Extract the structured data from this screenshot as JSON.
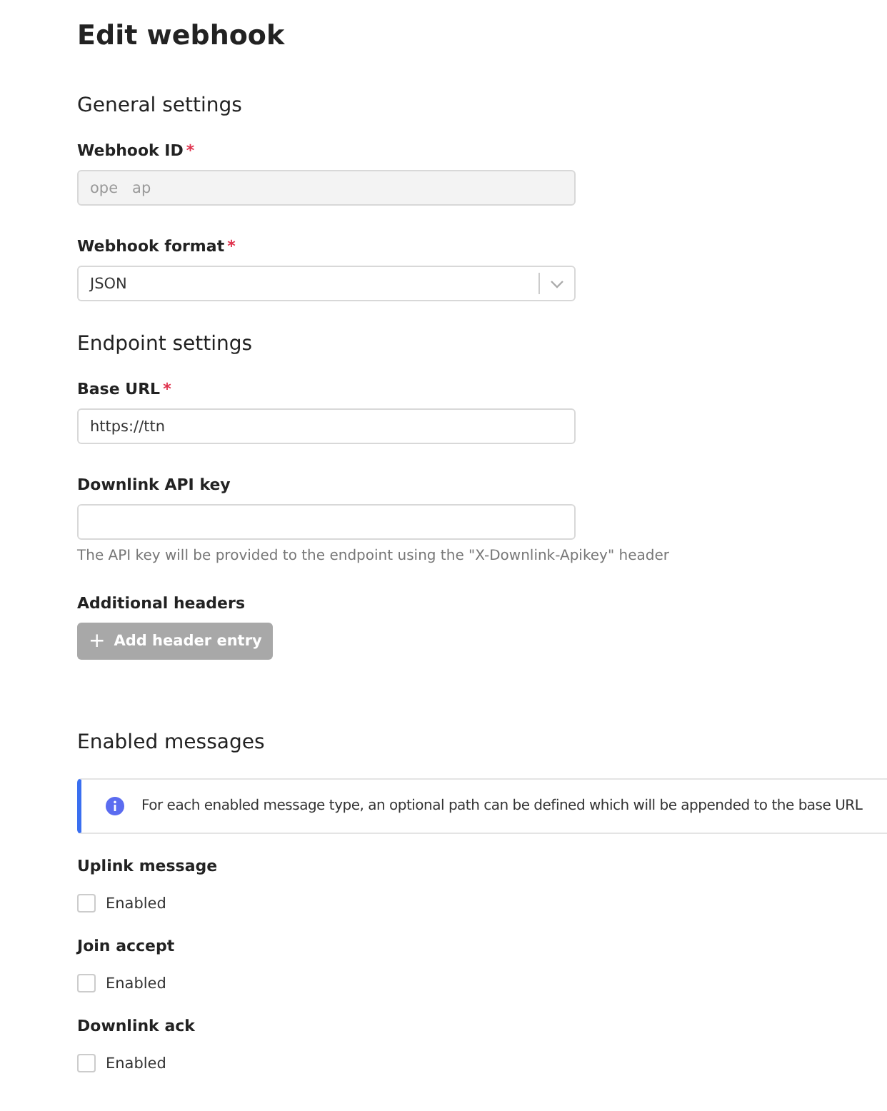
{
  "title": "Edit webhook",
  "general": {
    "heading": "General settings",
    "fields": [
      {
        "kind": "text",
        "label": "Webhook ID",
        "required_mark": "*",
        "value": "ope   ap",
        "disabled": true
      },
      {
        "kind": "select",
        "label": "Webhook format",
        "required_mark": "*",
        "value": "JSON",
        "disabled": false
      }
    ]
  },
  "endpoint": {
    "heading": "Endpoint settings",
    "fields": [
      {
        "kind": "text",
        "label": "Base URL",
        "required_mark": "*",
        "value": "https://ttn",
        "disabled": false
      },
      {
        "kind": "text",
        "label": "Downlink API key",
        "disabled": false,
        "description": "The API key will be provided to the endpoint using the \"X-Downlink-Apikey\" header"
      }
    ],
    "headers_label": "Additional headers",
    "add_button": {
      "icon": "+",
      "label": "Add header entry",
      "disabled": true
    }
  },
  "messages": {
    "heading": "Enabled messages",
    "notice": "For each enabled message type, an optional path can be defined which will be appended to the base URL",
    "items": [
      {
        "label": "Uplink message",
        "checkbox_label": "Enabled",
        "checked": false
      },
      {
        "label": "Join accept",
        "checkbox_label": "Enabled",
        "checked": false
      },
      {
        "label": "Downlink ack",
        "checkbox_label": "Enabled",
        "checked": false
      }
    ]
  }
}
